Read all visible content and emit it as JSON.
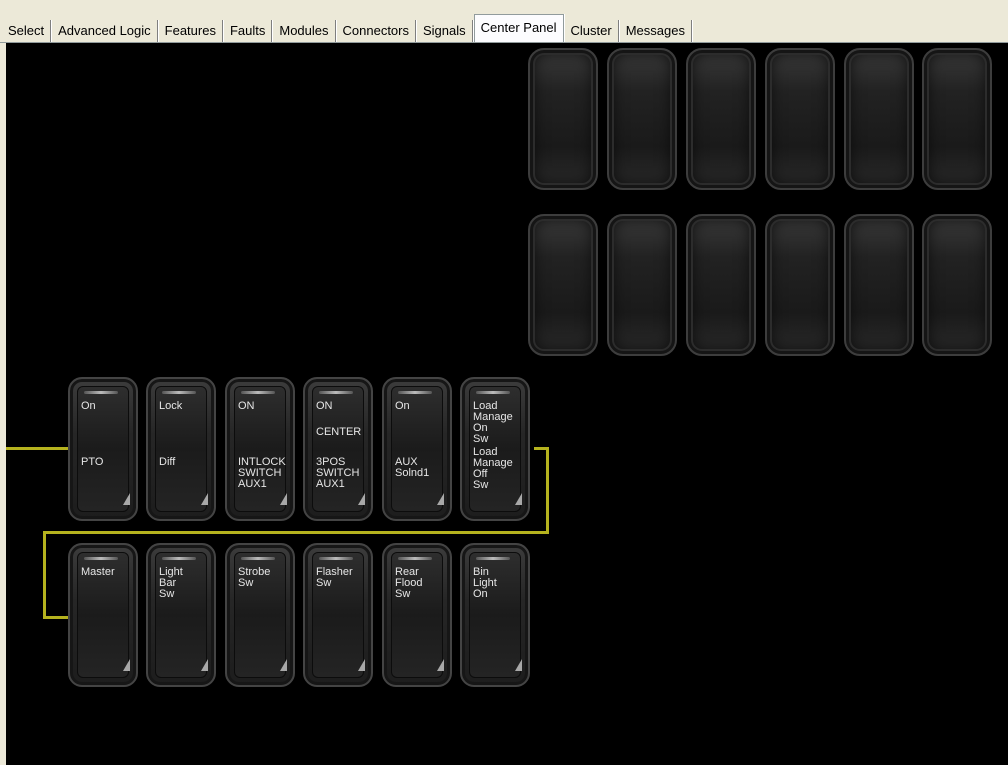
{
  "tabs": [
    {
      "label": "Select"
    },
    {
      "label": "Advanced Logic"
    },
    {
      "label": "Features"
    },
    {
      "label": "Faults"
    },
    {
      "label": "Modules"
    },
    {
      "label": "Connectors"
    },
    {
      "label": "Signals"
    },
    {
      "label": "Center Panel",
      "active": true
    },
    {
      "label": "Cluster"
    },
    {
      "label": "Messages"
    }
  ],
  "colors": {
    "panel_background": "#000000",
    "wire": "#b5b21e",
    "switch_text": "#e6e6e6"
  },
  "switch_rows": [
    [
      {
        "top": "On",
        "bottom": "PTO"
      },
      {
        "top": "Lock",
        "bottom": "Diff"
      },
      {
        "top": "ON",
        "bottom": "INTLOCK\nSWITCH\nAUX1"
      },
      {
        "top": "ON",
        "middle": "CENTER",
        "bottom": "3POS\nSWITCH\nAUX1"
      },
      {
        "top": "On",
        "bottom": "AUX\nSolnd1"
      },
      {
        "top": "Load\nManage\nOn\nSw",
        "bottom": "Load\nManage\nOff\nSw"
      }
    ],
    [
      {
        "top": "Master"
      },
      {
        "top": "Light\nBar\nSw"
      },
      {
        "top": "Strobe\nSw"
      },
      {
        "top": "Flasher\nSw"
      },
      {
        "top": "Rear\nFlood\nSw"
      },
      {
        "top": "Bin\nLight\nOn"
      }
    ]
  ]
}
